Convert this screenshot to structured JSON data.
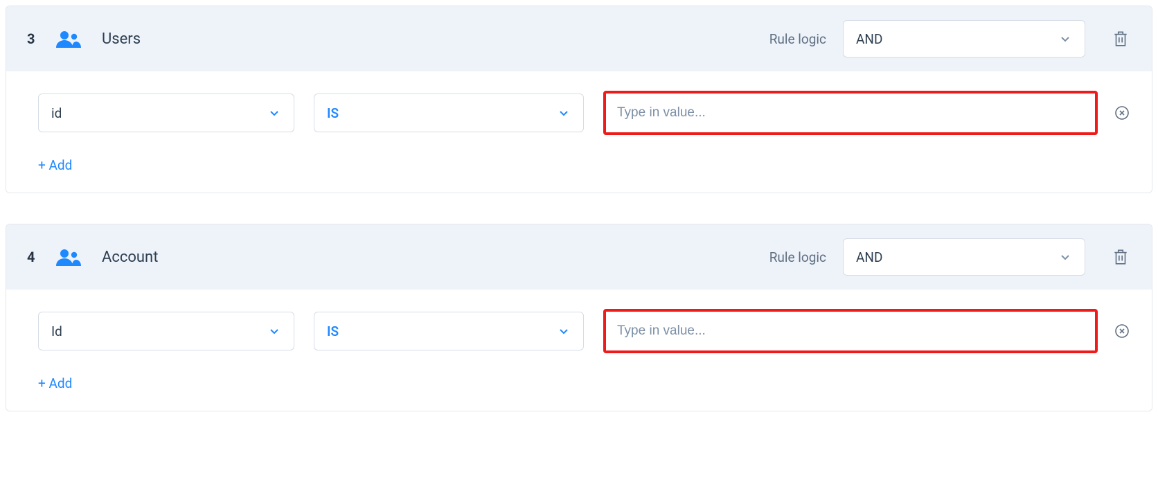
{
  "rules": [
    {
      "number": "3",
      "title": "Users",
      "logic_label": "Rule logic",
      "logic_value": "AND",
      "condition": {
        "field": "id",
        "operator": "IS",
        "value_placeholder": "Type in value..."
      },
      "add_label": "+ Add"
    },
    {
      "number": "4",
      "title": "Account",
      "logic_label": "Rule logic",
      "logic_value": "AND",
      "condition": {
        "field": "Id",
        "operator": "IS",
        "value_placeholder": "Type in value..."
      },
      "add_label": "+ Add"
    }
  ]
}
